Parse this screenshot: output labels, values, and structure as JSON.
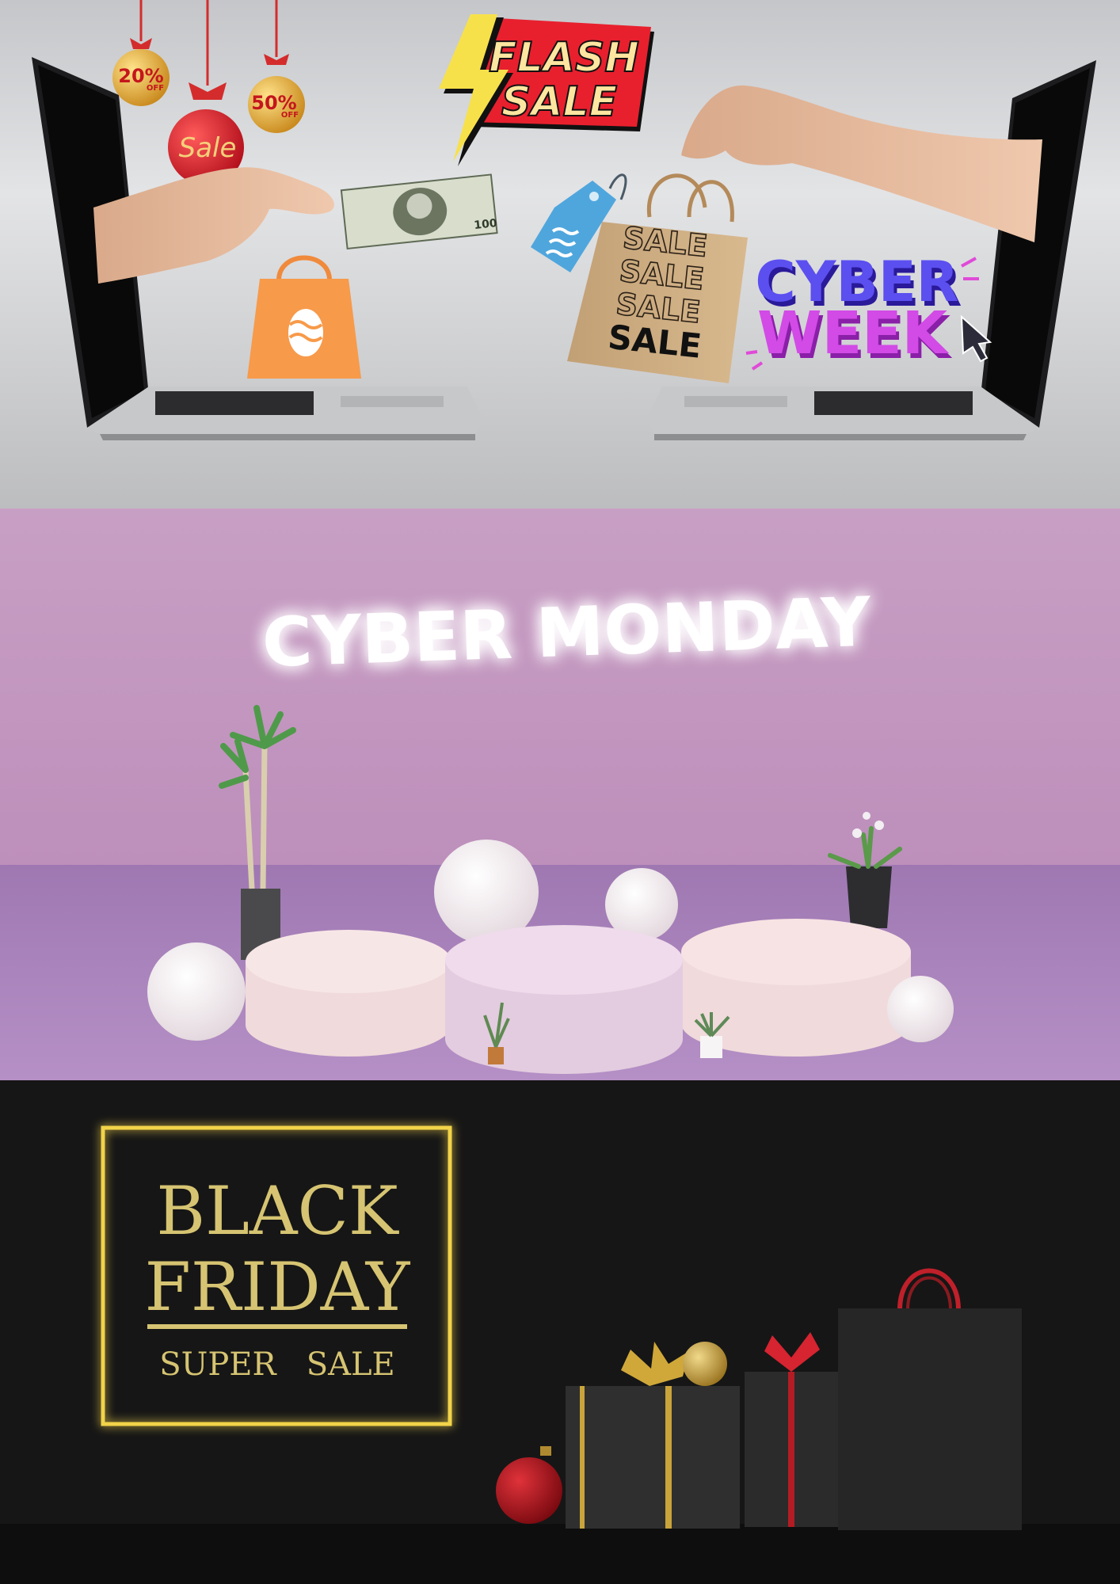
{
  "scene_top": {
    "flash_sale": {
      "line1": "FLASH",
      "line2": "SALE"
    },
    "ornaments": [
      {
        "label": "20%",
        "sub": "OFF"
      },
      {
        "label": "Sale",
        "sub": ""
      },
      {
        "label": "50%",
        "sub": "OFF"
      }
    ],
    "bag_text": [
      "SALE",
      "SALE",
      "SALE",
      "SALE"
    ],
    "cyber_week": {
      "line1": "CYBER",
      "line2": "WEEK"
    },
    "banknote_value": "100"
  },
  "scene_middle": {
    "neon_title": "CYBER MONDAY"
  },
  "scene_bottom": {
    "title_line1": "BLACK",
    "title_line2": "FRIDAY",
    "subtitle": "SUPER   SALE"
  },
  "colors": {
    "flash_red": "#e8202e",
    "flash_yellow": "#f7e14a",
    "cyber_blue": "#4b3fe0",
    "cyber_pink": "#d24be6",
    "neon_gold": "#f2d34a",
    "black_friday_text": "#d6c472"
  }
}
